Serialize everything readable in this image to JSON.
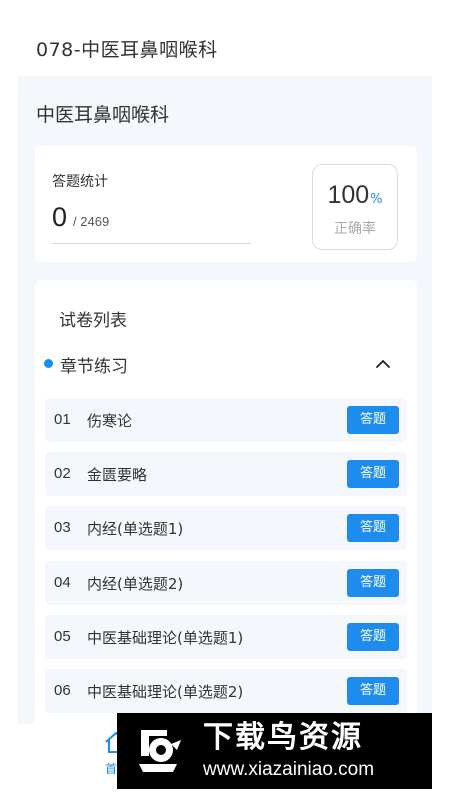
{
  "header": {
    "title": "078-中医耳鼻咽喉科"
  },
  "section": {
    "title": "中医耳鼻咽喉科"
  },
  "stats": {
    "label": "答题统计",
    "answered": "0",
    "total": "/ 2469",
    "accuracy_value": "100",
    "accuracy_unit": "%",
    "accuracy_label": "正确率"
  },
  "paper_list": {
    "title": "试卷列表",
    "chapter_label": "章节练习",
    "items": [
      {
        "num": "01",
        "name": "伤寒论",
        "button": "答题"
      },
      {
        "num": "02",
        "name": "金匮要略",
        "button": "答题"
      },
      {
        "num": "03",
        "name": "内经(单选题1)",
        "button": "答题"
      },
      {
        "num": "04",
        "name": "内经(单选题2)",
        "button": "答题"
      },
      {
        "num": "05",
        "name": "中医基础理论(单选题1)",
        "button": "答题"
      },
      {
        "num": "06",
        "name": "中医基础理论(单选题2)",
        "button": "答题"
      }
    ]
  },
  "bottom_nav": {
    "home_label": "首"
  },
  "watermark": {
    "title": "下载鸟资源",
    "url": "www.xiazainiao.com"
  },
  "colors": {
    "accent": "#1e8cec",
    "page_bg": "#f4f7fc",
    "item_bg": "#f4f7fc"
  },
  "icons": {
    "chapter_toggle": "chevron-up-icon",
    "home": "home-icon",
    "watermark_logo": "bird-logo-icon"
  }
}
